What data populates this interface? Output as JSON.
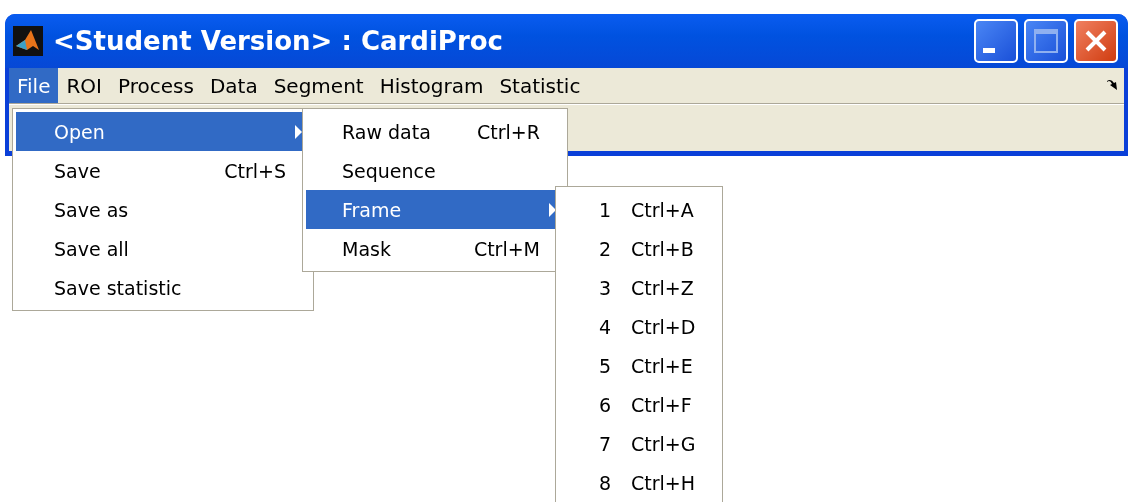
{
  "window": {
    "title": "<Student Version> : CardiProc"
  },
  "menu_bar": [
    {
      "label": "File",
      "selected": true
    },
    {
      "label": "ROI",
      "selected": false
    },
    {
      "label": "Process",
      "selected": false
    },
    {
      "label": "Data",
      "selected": false
    },
    {
      "label": "Segment",
      "selected": false
    },
    {
      "label": "Histogram",
      "selected": false
    },
    {
      "label": "Statistic",
      "selected": false
    }
  ],
  "file_menu": [
    {
      "label": "Open",
      "submenu": true,
      "selected": true
    },
    {
      "label": "Save",
      "shortcut": "Ctrl+S",
      "submenu": false,
      "selected": false
    },
    {
      "label": "Save as",
      "submenu": false,
      "selected": false
    },
    {
      "label": "Save all",
      "submenu": false,
      "selected": false
    },
    {
      "label": "Save statistic",
      "submenu": false,
      "selected": false
    }
  ],
  "open_submenu": [
    {
      "label": "Raw data",
      "shortcut": "Ctrl+R",
      "submenu": false,
      "selected": false
    },
    {
      "label": "Sequence",
      "submenu": false,
      "selected": false
    },
    {
      "label": "Frame",
      "submenu": true,
      "selected": true
    },
    {
      "label": "Mask",
      "shortcut": "Ctrl+M",
      "submenu": false,
      "selected": false
    }
  ],
  "frame_submenu": [
    {
      "label": "1",
      "shortcut": "Ctrl+A",
      "selected": false
    },
    {
      "label": "2",
      "shortcut": "Ctrl+B",
      "selected": false
    },
    {
      "label": "3",
      "shortcut": "Ctrl+Z",
      "selected": false
    },
    {
      "label": "4",
      "shortcut": "Ctrl+D",
      "selected": false
    },
    {
      "label": "5",
      "shortcut": "Ctrl+E",
      "selected": false
    },
    {
      "label": "6",
      "shortcut": "Ctrl+F",
      "selected": false
    },
    {
      "label": "7",
      "shortcut": "Ctrl+G",
      "selected": false
    },
    {
      "label": "8",
      "shortcut": "Ctrl+H",
      "selected": false
    }
  ]
}
